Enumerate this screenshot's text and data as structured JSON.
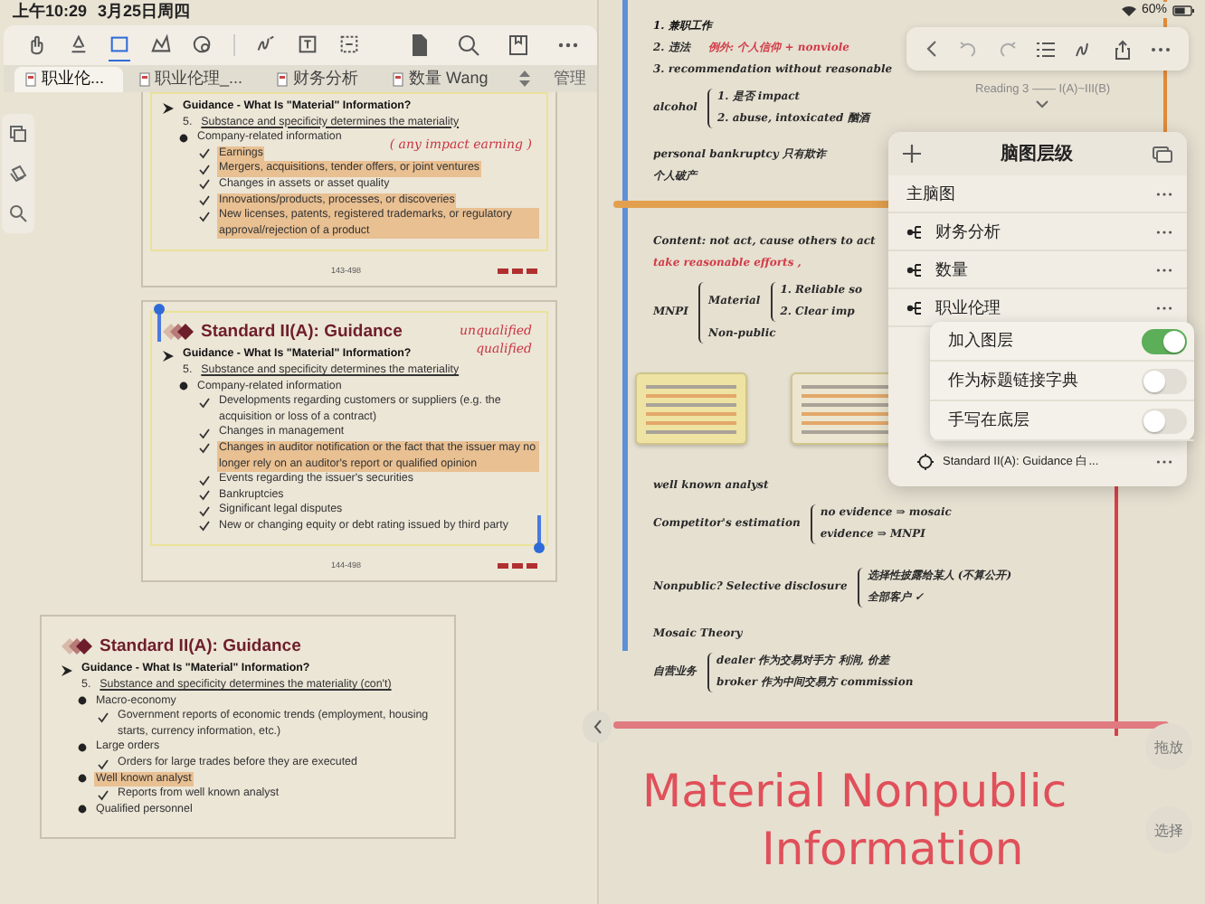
{
  "status_bar": {
    "time": "上午10:29",
    "date": "3月25日周四",
    "battery": "60%"
  },
  "toolbar": {
    "tools": [
      {
        "kind": "hand",
        "selected": false
      },
      {
        "kind": "highlighter",
        "selected": false
      },
      {
        "kind": "frame",
        "selected": true
      },
      {
        "kind": "shape",
        "selected": false
      },
      {
        "kind": "sticker",
        "selected": false
      },
      {
        "kind": "curve",
        "selected": false
      },
      {
        "kind": "textbox",
        "selected": false
      },
      {
        "kind": "dashed",
        "selected": false
      }
    ]
  },
  "tabs": [
    {
      "label": "职业伦...",
      "selected": true
    },
    {
      "label": "职业伦理_...",
      "selected": false
    },
    {
      "label": "财务分析",
      "selected": false
    },
    {
      "label": "数量 Wang",
      "selected": false
    }
  ],
  "manage": "管理",
  "pages": [
    {
      "selected": false,
      "annotations": [
        "( any impact earning )"
      ],
      "page_number": "143-498",
      "items": [
        {
          "kind": "arrow",
          "text": "Guidance - What Is \"Material\" Information?",
          "highlighted": false
        },
        {
          "kind": "number",
          "marker": "5.",
          "text": "Substance and specificity determines the materiality",
          "highlighted": false
        },
        {
          "kind": "bullet",
          "text": "Company-related information",
          "highlighted": false,
          "children": [
            {
              "kind": "check",
              "text": "Earnings",
              "highlighted": true
            },
            {
              "kind": "check",
              "text": "Mergers, acquisitions, tender offers, or joint ventures",
              "highlighted": true
            },
            {
              "kind": "check",
              "text": "Changes in assets or asset quality",
              "highlighted": false
            },
            {
              "kind": "check",
              "text": "Innovations/products, processes, or discoveries",
              "highlighted": true
            },
            {
              "kind": "check",
              "text": "New licenses, patents, registered trademarks, or regulatory approval/rejection of a product",
              "highlighted": true
            }
          ]
        }
      ]
    },
    {
      "selected": true,
      "title": "Standard II(A): Guidance",
      "annotations": [
        "unqualified",
        "qualified"
      ],
      "page_number": "144-498",
      "items": [
        {
          "kind": "arrow",
          "text": "Guidance - What Is \"Material\" Information?",
          "highlighted": false
        },
        {
          "kind": "number",
          "marker": "5.",
          "text": "Substance and specificity determines the materiality",
          "highlighted": false
        },
        {
          "kind": "bullet",
          "text": "Company-related information",
          "highlighted": false,
          "children": [
            {
              "kind": "check",
              "text": "Developments regarding customers or suppliers (e.g. the acquisition or loss of a contract)",
              "highlighted": false
            },
            {
              "kind": "check",
              "text": "Changes in management",
              "highlighted": false
            },
            {
              "kind": "check",
              "text": "Changes in auditor notification or the fact that the issuer may no longer rely on an auditor's report or qualified opinion",
              "highlighted": true
            },
            {
              "kind": "check",
              "text": "Events regarding the issuer's securities",
              "highlighted": false
            },
            {
              "kind": "check",
              "text": "Bankruptcies",
              "highlighted": false
            },
            {
              "kind": "check",
              "text": "Significant legal disputes",
              "highlighted": false
            },
            {
              "kind": "check",
              "text": "New or changing equity or debt rating issued by third party",
              "highlighted": false
            }
          ]
        }
      ]
    },
    {
      "selected": false,
      "title": "Standard II(A): Guidance",
      "items": [
        {
          "kind": "arrow",
          "text": "Guidance - What Is \"Material\" Information?",
          "highlighted": false
        },
        {
          "kind": "number",
          "marker": "5.",
          "text": "Substance and specificity determines the materiality (con't)",
          "highlighted": false
        },
        {
          "kind": "bullet",
          "text": "Macro-economy",
          "highlighted": false,
          "children": [
            {
              "kind": "check",
              "text": "Government reports of economic trends (employment, housing starts, currency information, etc.)",
              "highlighted": false
            }
          ]
        },
        {
          "kind": "bullet",
          "text": "Large orders",
          "highlighted": false,
          "children": [
            {
              "kind": "check",
              "text": "Orders for large trades before they are executed",
              "highlighted": false
            }
          ]
        },
        {
          "kind": "bullet",
          "text": "Well known analyst",
          "highlighted": true,
          "children": [
            {
              "kind": "check",
              "text": "Reports from well known analyst",
              "highlighted": false
            }
          ]
        },
        {
          "kind": "bullet",
          "text": "Qualified personnel",
          "highlighted": false
        }
      ]
    }
  ],
  "canvas": {
    "notes": [
      {
        "kind": "line",
        "text": "1. 兼职工作",
        "color": "#111111"
      },
      {
        "kind": "line",
        "text": "2. 违法",
        "color": "#2a2a2a",
        "aside": {
          "text": "例外: 个人信仰 + nonviole",
          "color": "#d23b47"
        }
      },
      {
        "kind": "line",
        "text": "3. recommendation without reasonable",
        "color": "#2a2a2a"
      },
      {
        "kind": "brace",
        "text": "alcohol",
        "color": "#2a2a2a",
        "children": [
          {
            "text": "1. 是否 impact"
          },
          {
            "text": "2. abuse, intoxicated 酗酒"
          }
        ]
      },
      {
        "kind": "line",
        "text": "personal bankruptcy   只有欺诈",
        "color": "#2a2a2a"
      },
      {
        "kind": "line",
        "text": "个人破产",
        "color": "#2a2a2a"
      },
      {
        "kind": "divider",
        "color": "#e2a04e"
      },
      {
        "kind": "line",
        "text": "Content: not act, cause others to act",
        "color": "#2a2a2a"
      },
      {
        "kind": "line",
        "text": "take reasonable efforts ,",
        "color": "#d23b47"
      },
      {
        "kind": "brace",
        "text": "MNPI",
        "color": "#2a2a2a",
        "children": [
          {
            "text": "Material",
            "children": [
              {
                "text": "1. Reliable so"
              },
              {
                "text": "2. Clear imp"
              }
            ]
          },
          {
            "text": "Non-public"
          }
        ]
      },
      {
        "kind": "thumbnails",
        "items": [
          {
            "color": "#eee3a2"
          },
          {
            "color": "#ece6d0"
          }
        ]
      },
      {
        "kind": "line",
        "text": "well known analyst",
        "color": "#2a2a2a"
      },
      {
        "kind": "brace",
        "text": "Competitor's estimation",
        "color": "#2a2a2a",
        "children": [
          {
            "text": "no evidence ⇒ mosaic"
          },
          {
            "text": "evidence ⇒ MNPI"
          }
        ]
      },
      {
        "kind": "brace",
        "text": "Nonpublic?  Selective disclosure",
        "color": "#2a2a2a",
        "children": [
          {
            "text": "选择性披露给某人 (不算公开)"
          },
          {
            "text": "全部客户 ✓"
          }
        ]
      },
      {
        "kind": "line",
        "text": "Mosaic Theory",
        "color": "#2a2a2a"
      },
      {
        "kind": "brace",
        "text": "自营业务",
        "color": "#2a2a2a",
        "children": [
          {
            "text": "dealer 作为交易对手方 利润, 价差"
          },
          {
            "text": "broker 作为中间交易方 commission"
          }
        ]
      },
      {
        "kind": "divider",
        "color": "#e07a80"
      },
      {
        "kind": "title",
        "text": "Material Nonpublic",
        "color": "#e0505a"
      },
      {
        "kind": "title",
        "text": "Information",
        "color": "#e0505a"
      }
    ]
  },
  "reading_label": "Reading 3 —— I(A)~III(B)",
  "layers_panel": {
    "title": "脑图层级",
    "items": [
      {
        "kind": "root",
        "label": "主脑图"
      },
      {
        "kind": "mindmap",
        "label": "财务分析"
      },
      {
        "kind": "mindmap",
        "label": "数量"
      },
      {
        "kind": "mindmap",
        "label": "职业伦理"
      },
      {
        "kind": "page",
        "label": "Standard II(A): Guidance 白..."
      }
    ],
    "options": [
      {
        "label": "加入图层",
        "on": true
      },
      {
        "label": "作为标题链接字典",
        "on": false
      },
      {
        "label": "手写在底层",
        "on": false
      }
    ]
  },
  "side_buttons": [
    "拖放",
    "选择"
  ]
}
